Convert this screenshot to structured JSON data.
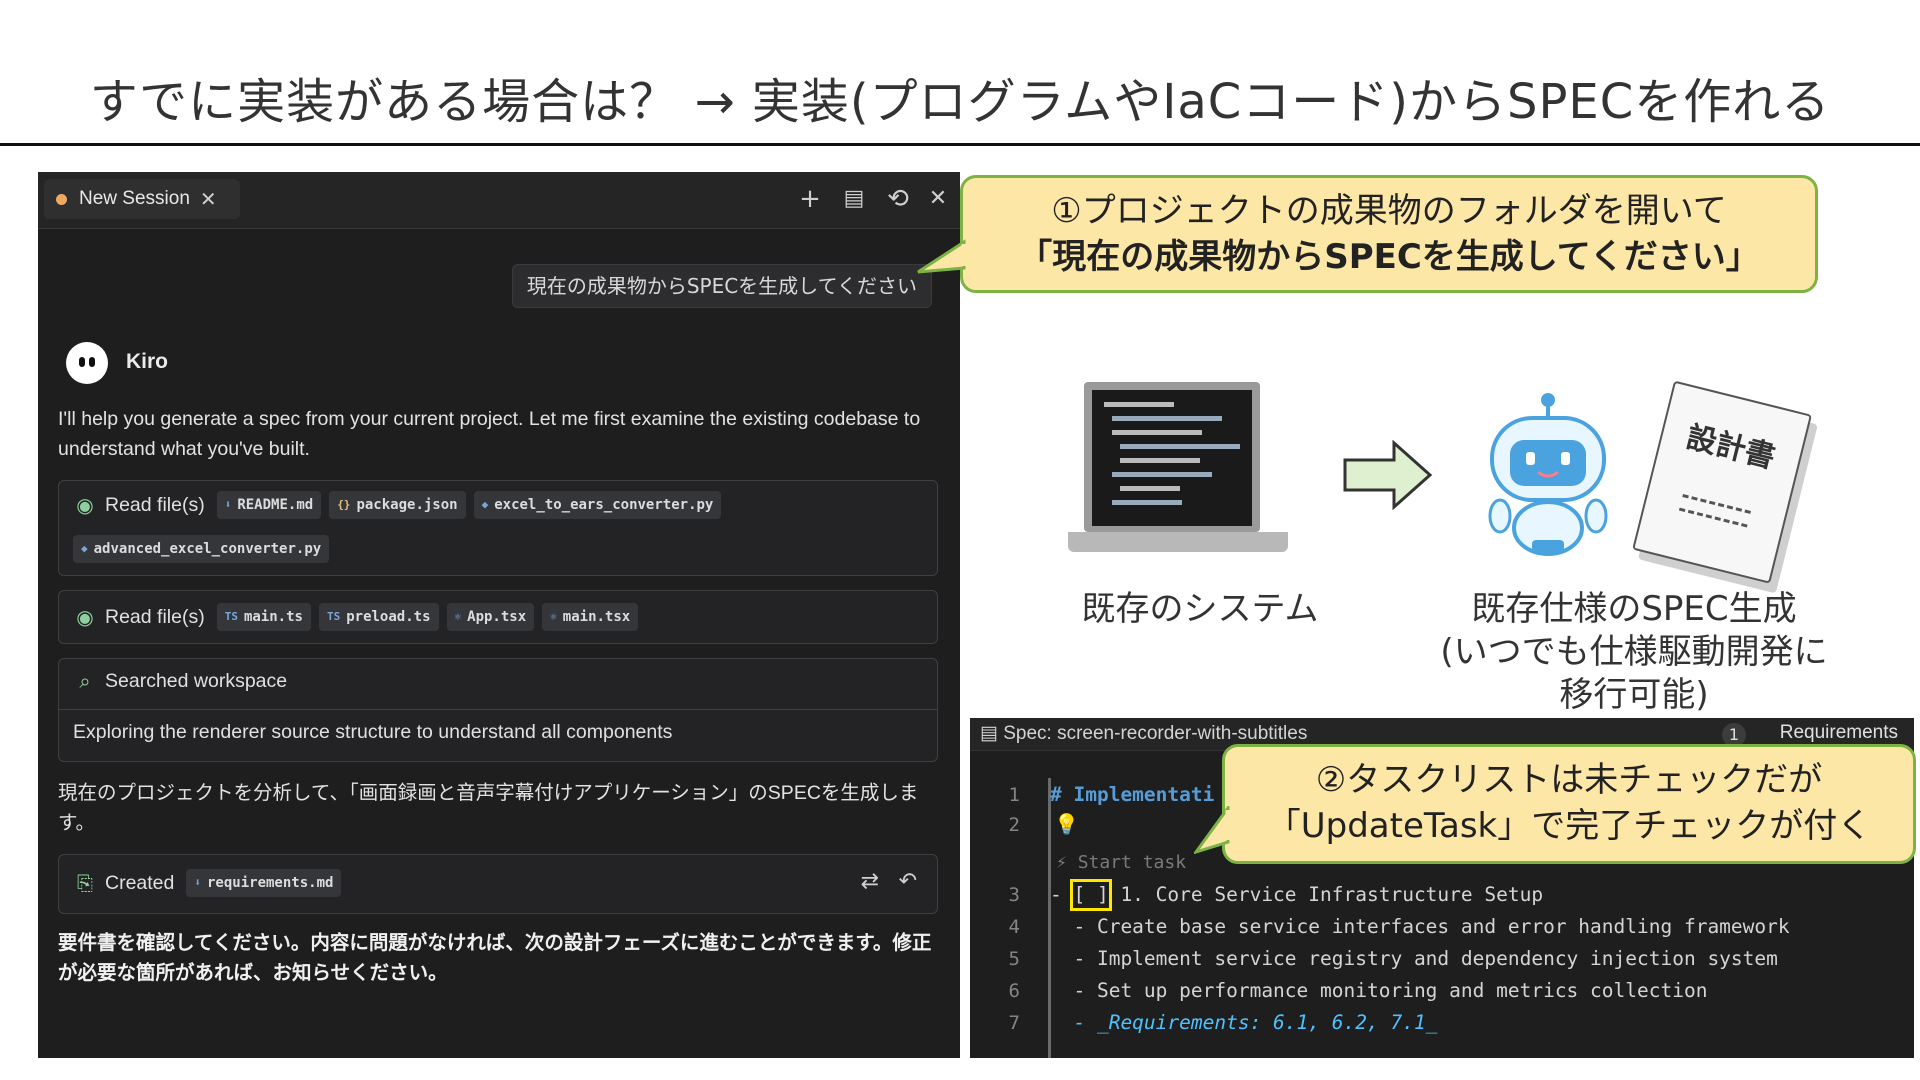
{
  "slide": {
    "title": "すでに実装がある場合は？ → 実装(プログラムやIaCコード)からSPECを作れる"
  },
  "chat": {
    "tab_label": "New Session",
    "tab_close": "✕",
    "toolbar": {
      "new": "+",
      "history": "⟲",
      "close": "✕",
      "clipboard": "▤"
    },
    "user_message": "現在の成果物からSPECを生成してください",
    "agent_name": "Kiro",
    "intro": "I'll help you generate a spec from your current project. Let me first examine the existing codebase to understand what you've built.",
    "read1": {
      "label": "Read file(s)",
      "files": [
        "README.md",
        "package.json",
        "excel_to_ears_converter.py",
        "advanced_excel_converter.py"
      ]
    },
    "read2": {
      "label": "Read file(s)",
      "files": [
        "main.ts",
        "preload.ts",
        "App.tsx",
        "main.tsx"
      ]
    },
    "search": {
      "label": "Searched workspace",
      "detail": "Exploring the renderer source structure to understand all components"
    },
    "analysis": "現在のプロジェクトを分析して、「画面録画と音声字幕付けアプリケーション」のSPECを生成します。",
    "created": {
      "label": "Created",
      "file": "requirements.md"
    },
    "final": "要件書を確認してください。内容に問題がなければ、次の設計フェーズに進むことができます。修正が必要な箇所があれば、お知らせください。"
  },
  "callout1": {
    "line1": "①プロジェクトの成果物のフォルダを開いて",
    "line2": "「現在の成果物からSPECを生成してください」"
  },
  "callout2": {
    "line1": "②タスクリストは未チェックだが",
    "line2": "「UpdateTask」で完了チェックが付く"
  },
  "illustration": {
    "left_caption": "既存のシステム",
    "right_caption_line1": "既存仕様のSPEC生成",
    "right_caption_line2": "(いつでも仕様駆動開発に",
    "right_caption_line3": "移行可能)",
    "doc_label": "設計書"
  },
  "editor": {
    "title": "Spec: screen-recorder-with-subtitles",
    "badge": "1",
    "tab": "Requirements",
    "start_task": "Start task",
    "lines": [
      {
        "no": "1",
        "text": "# Implementati"
      },
      {
        "no": "2",
        "text": ""
      },
      {
        "no": "3",
        "text": "- [ ] 1. Core Service Infrastructure Setup"
      },
      {
        "no": "4",
        "text": "  - Create base service interfaces and error handling framework"
      },
      {
        "no": "5",
        "text": "  - Implement service registry and dependency injection system"
      },
      {
        "no": "6",
        "text": "  - Set up performance monitoring and metrics collection"
      },
      {
        "no": "7",
        "text": "  - _Requirements: 6.1, 6.2, 7.1_"
      }
    ]
  },
  "colors": {
    "callout_fill": "#fde7a6",
    "callout_border": "#7cb342",
    "chat_bg": "#1e1e1e",
    "highlight": "#ffe600"
  }
}
